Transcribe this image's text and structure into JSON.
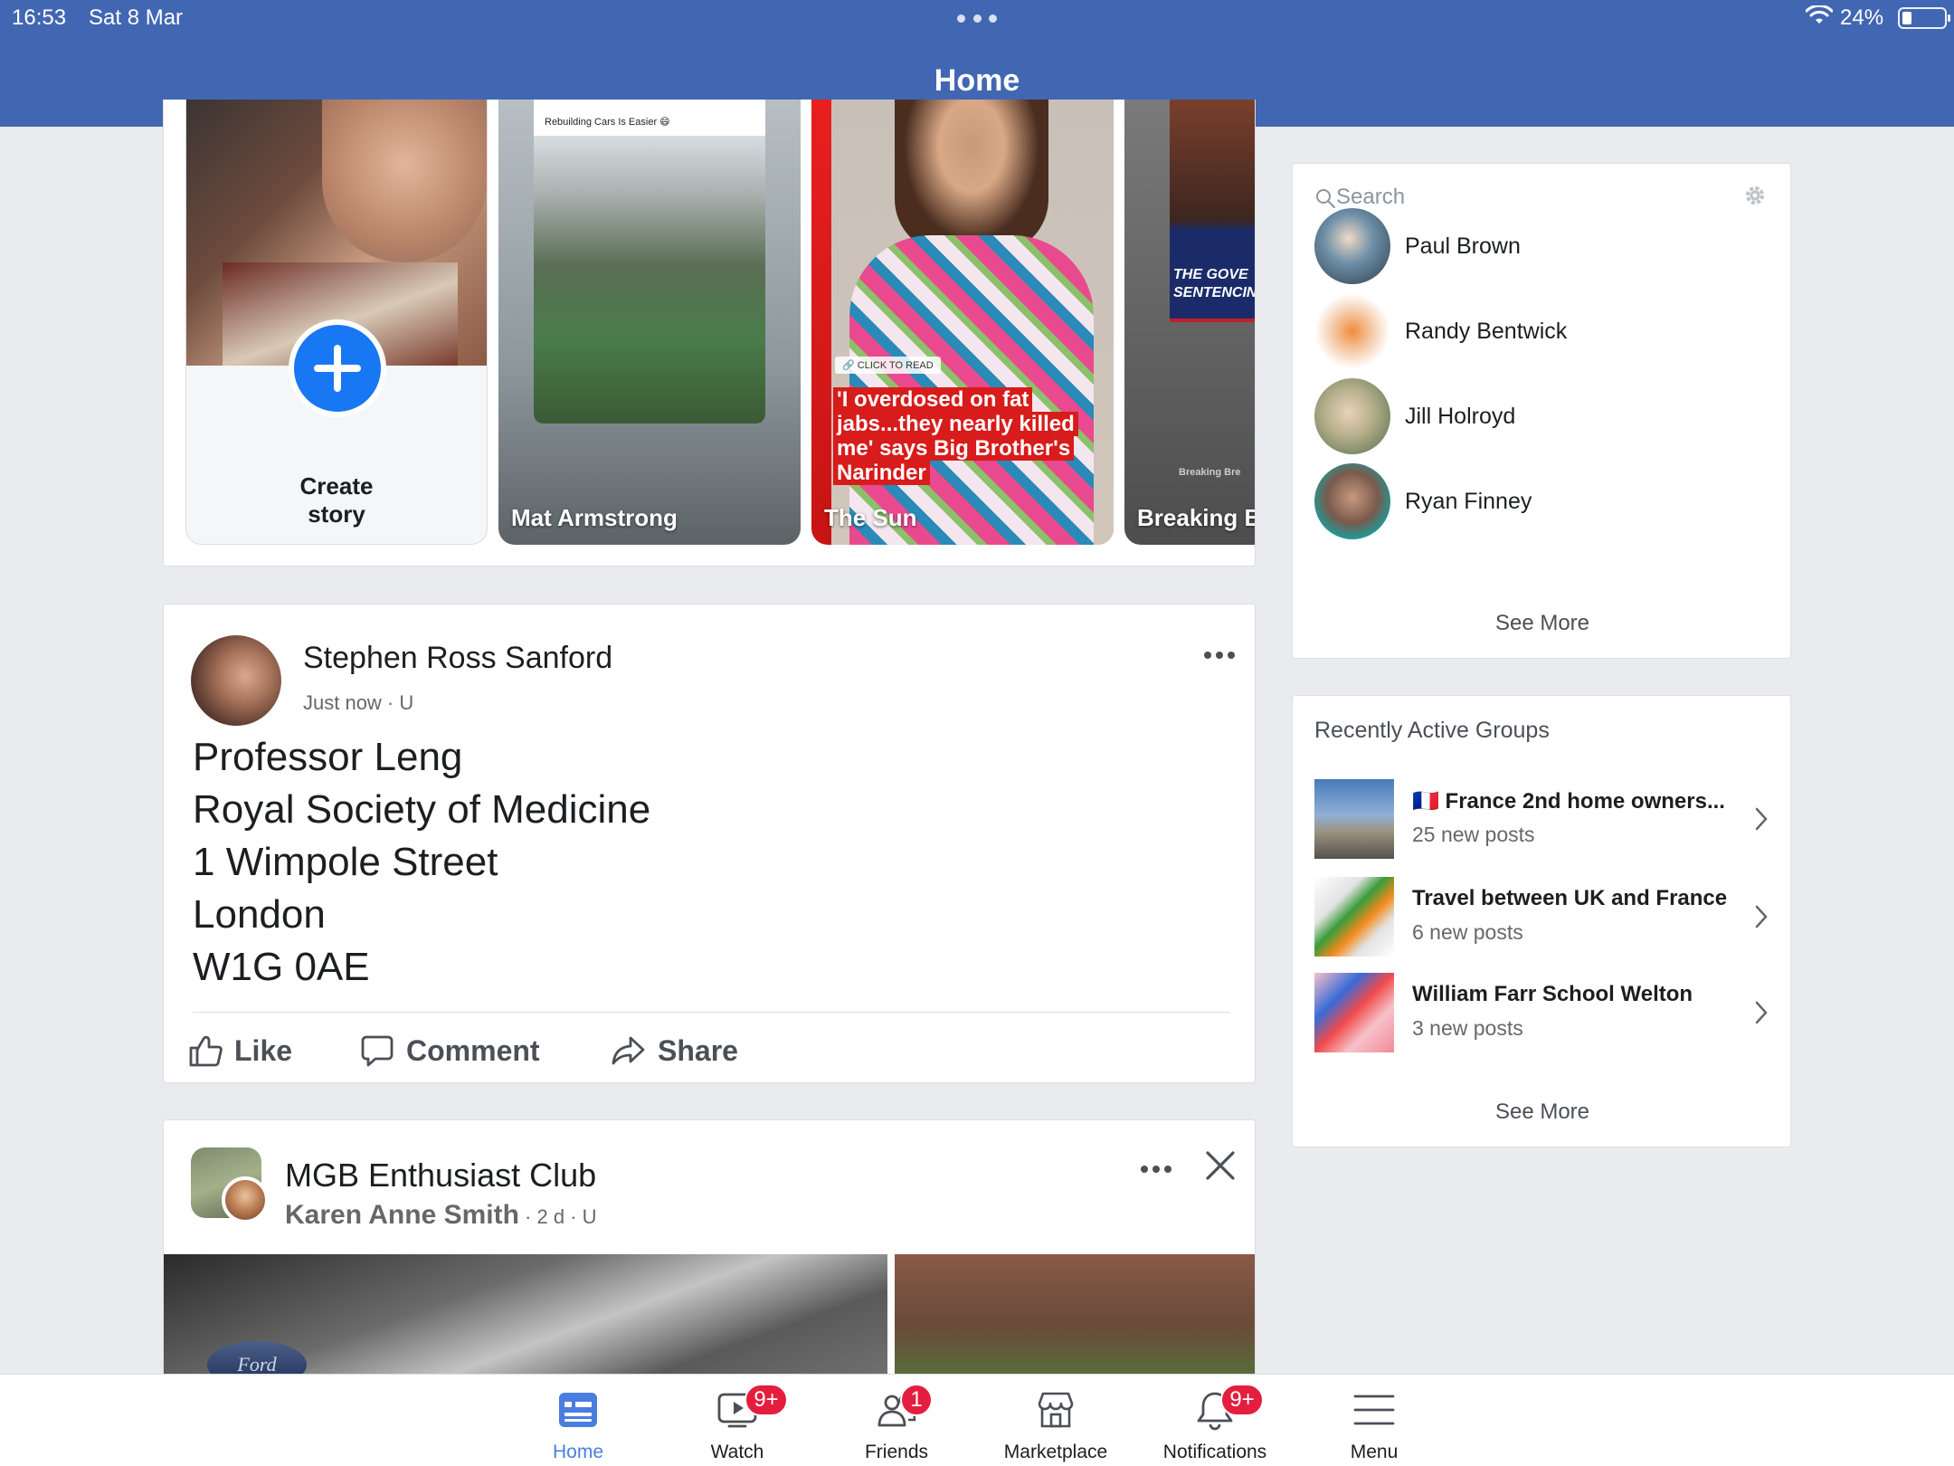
{
  "status_bar": {
    "time": "16:53",
    "date": "Sat 8 Mar",
    "battery": "24%"
  },
  "header": {
    "title": "Home"
  },
  "stories": {
    "create_label": "Create\nstory",
    "items": [
      {
        "name": "Mat Armstrong",
        "caption": "Rebuilding Cars Is Easier 😄"
      },
      {
        "name": "The Sun",
        "tag": "🔗 CLICK TO READ",
        "headline": "'I overdosed on fat jabs...they nearly killed me' says Big Brother's Narinder"
      },
      {
        "name": "Breaking Br",
        "overlay": "THE GOVE\nSENTENCING",
        "sub": "Breaking Bre"
      }
    ]
  },
  "post1": {
    "author": "Stephen Ross Sanford",
    "meta": "Just now · U",
    "body_lines": [
      "Professor Leng",
      "Royal Society of Medicine",
      "1 Wimpole Street",
      "London",
      "W1G 0AE"
    ],
    "actions": {
      "like": "Like",
      "comment": "Comment",
      "share": "Share"
    }
  },
  "post2": {
    "group": "MGB Enthusiast Club",
    "author": "Karen Anne Smith",
    "meta": " · 2 d · U",
    "badge_text": "Ford"
  },
  "contacts": {
    "search_placeholder": "Search",
    "items": [
      {
        "name": "Paul Brown"
      },
      {
        "name": "Randy Bentwick"
      },
      {
        "name": "Jill Holroyd"
      },
      {
        "name": "Ryan Finney"
      }
    ],
    "see_more": "See More"
  },
  "groups": {
    "title": "Recently Active Groups",
    "items": [
      {
        "name": "🇫🇷 France 2nd home owners...",
        "posts": "25 new posts"
      },
      {
        "name": "Travel between UK and France",
        "posts": "6 new posts"
      },
      {
        "name": "William Farr School Welton",
        "posts": "3 new posts"
      }
    ],
    "see_more": "See More"
  },
  "tabbar": {
    "tabs": [
      {
        "label": "Home",
        "badge": ""
      },
      {
        "label": "Watch",
        "badge": "9+"
      },
      {
        "label": "Friends",
        "badge": "1"
      },
      {
        "label": "Marketplace",
        "badge": ""
      },
      {
        "label": "Notifications",
        "badge": "9+"
      },
      {
        "label": "Menu",
        "badge": ""
      }
    ]
  },
  "colors": {
    "header_blue": "#4267b2",
    "accent_blue": "#1877f2",
    "badge_red": "#e41e3f",
    "sun_red": "#d81b1b",
    "active_tab": "#4a7de0"
  }
}
